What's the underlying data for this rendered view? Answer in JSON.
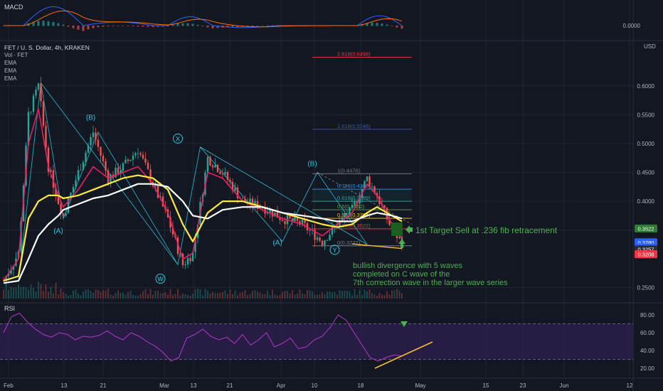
{
  "header": {
    "symbol": "FET / U. S. Dollar, 4h, KRAKEN",
    "indicators": [
      "Vol · FET",
      "EMA",
      "EMA",
      "EMA"
    ],
    "currency": "USD"
  },
  "macd": {
    "label": "MACD",
    "value_label": "0.0000"
  },
  "rsi": {
    "label": "RSI",
    "ticks": [
      80,
      60,
      40,
      20
    ],
    "tick_labels": [
      "80.00",
      "60.00",
      "40.00",
      "20.00"
    ],
    "band": [
      30,
      70
    ],
    "values": [
      60,
      78,
      82,
      72,
      64,
      58,
      55,
      60,
      58,
      52,
      56,
      55,
      57,
      62,
      56,
      52,
      60,
      56,
      50,
      45,
      38,
      28,
      32,
      54,
      58,
      64,
      56,
      52,
      55,
      48,
      58,
      46,
      52,
      60,
      44,
      48,
      54,
      42,
      44,
      52,
      56,
      66,
      80,
      74,
      60,
      46,
      32,
      28,
      32,
      35,
      34
    ]
  },
  "chart_data": {
    "type": "candlestick",
    "title": "FET / U. S. Dollar, 4h, KRAKEN",
    "ylabel": "USD",
    "ylim": [
      0.225,
      0.675
    ],
    "x_ticks": [
      "Feb",
      "13",
      "21",
      "Mar",
      "13",
      "21",
      "Apr",
      "10",
      "18",
      "May",
      "15",
      "23",
      "Jun",
      "12"
    ],
    "y_ticks": [
      "0.6000",
      "0.5500",
      "0.5000",
      "0.4500",
      "0.4000",
      "0.3500",
      "0.2500"
    ],
    "price_path": [
      {
        "t": 0,
        "p": 0.262
      },
      {
        "t": 3,
        "p": 0.31
      },
      {
        "t": 5,
        "p": 0.55
      },
      {
        "t": 7,
        "p": 0.6
      },
      {
        "t": 9,
        "p": 0.46
      },
      {
        "t": 11,
        "p": 0.4
      },
      {
        "t": 12,
        "p": 0.375
      },
      {
        "t": 15,
        "p": 0.45
      },
      {
        "t": 18,
        "p": 0.52
      },
      {
        "t": 21,
        "p": 0.44
      },
      {
        "t": 24,
        "p": 0.46
      },
      {
        "t": 27,
        "p": 0.49
      },
      {
        "t": 30,
        "p": 0.43
      },
      {
        "t": 33,
        "p": 0.37
      },
      {
        "t": 36,
        "p": 0.29
      },
      {
        "t": 38,
        "p": 0.31
      },
      {
        "t": 41,
        "p": 0.475
      },
      {
        "t": 44,
        "p": 0.45
      },
      {
        "t": 48,
        "p": 0.4
      },
      {
        "t": 52,
        "p": 0.39
      },
      {
        "t": 56,
        "p": 0.37
      },
      {
        "t": 60,
        "p": 0.36
      },
      {
        "t": 64,
        "p": 0.33
      },
      {
        "t": 67,
        "p": 0.36
      },
      {
        "t": 70,
        "p": 0.385
      },
      {
        "t": 73,
        "p": 0.44
      },
      {
        "t": 75,
        "p": 0.41
      },
      {
        "t": 78,
        "p": 0.35
      },
      {
        "t": 80,
        "p": 0.33
      }
    ],
    "ema_series": [
      {
        "color": "#e91e63",
        "values": [
          0.262,
          0.3,
          0.5,
          0.56,
          0.46,
          0.41,
          0.39,
          0.42,
          0.46,
          0.44,
          0.45,
          0.46,
          0.43,
          0.38,
          0.3,
          0.31,
          0.45,
          0.44,
          0.4,
          0.385,
          0.37,
          0.36,
          0.34,
          0.36,
          0.38,
          0.43,
          0.41,
          0.36,
          0.335
        ]
      },
      {
        "color": "#ffeb3b",
        "values": [
          0.262,
          0.27,
          0.37,
          0.4,
          0.41,
          0.41,
          0.405,
          0.41,
          0.42,
          0.43,
          0.44,
          0.445,
          0.44,
          0.42,
          0.36,
          0.33,
          0.38,
          0.4,
          0.4,
          0.39,
          0.38,
          0.37,
          0.36,
          0.355,
          0.36,
          0.38,
          0.39,
          0.375,
          0.365
        ]
      },
      {
        "color": "#ffffff",
        "values": [
          0.258,
          0.262,
          0.3,
          0.34,
          0.36,
          0.375,
          0.385,
          0.395,
          0.405,
          0.41,
          0.42,
          0.43,
          0.43,
          0.425,
          0.4,
          0.375,
          0.37,
          0.385,
          0.39,
          0.39,
          0.38,
          0.375,
          0.37,
          0.365,
          0.365,
          0.375,
          0.38,
          0.375,
          0.37
        ]
      }
    ],
    "fib_levels": [
      {
        "label": "2.618(0.6498)",
        "value": 0.6498,
        "color": "#f23645"
      },
      {
        "label": "1.618(0.5248)",
        "value": 0.5248,
        "color": "#3f51b5"
      },
      {
        "label": "1(0.4476)",
        "value": 0.4476,
        "color": "#787b86"
      },
      {
        "label": "0.786(0.4209)",
        "value": 0.4209,
        "color": "#2196f3"
      },
      {
        "label": "0.618(0.3999)",
        "value": 0.3999,
        "color": "#26a69a"
      },
      {
        "label": "0.5(0.3852)",
        "value": 0.3852,
        "color": "#4caf50"
      },
      {
        "label": "0.382(0.3704)",
        "value": 0.3704,
        "color": "#fbc02d"
      },
      {
        "label": "0.236(0.3522)",
        "value": 0.3522,
        "color": "#f23645"
      },
      {
        "label": "0(0.3227)",
        "value": 0.3227,
        "color": "#787b86"
      }
    ],
    "wave_labels": [
      {
        "text": "(A)",
        "t": 11,
        "p": 0.345
      },
      {
        "text": "(B)",
        "t": 17.5,
        "p": 0.542
      },
      {
        "text": "W",
        "t": 31.5,
        "p": 0.262
      },
      {
        "text": "X",
        "t": 35,
        "p": 0.505
      },
      {
        "text": "(A)",
        "t": 55,
        "p": 0.325
      },
      {
        "text": "(B)",
        "t": 62,
        "p": 0.462
      },
      {
        "text": "Y",
        "t": 66.5,
        "p": 0.312
      }
    ],
    "price_badges": [
      {
        "label": "0.3522",
        "value": 0.3522,
        "color": "#2e7d32"
      },
      {
        "label": "FETUSD",
        "value": 0.329,
        "color": "#2a2e39"
      },
      {
        "label": "0.3280",
        "value": 0.328,
        "color": "#2962ff"
      },
      {
        "label": "40:39",
        "value": 0.319,
        "color": "#2962ff"
      },
      {
        "label": "0.3257",
        "value": 0.316,
        "color": "#2a2e39"
      },
      {
        "label": "0.3208",
        "value": 0.3075,
        "color": "#f23645"
      }
    ]
  },
  "annotations": {
    "target": "1st Target Sell at .236 fib retracement",
    "note_lines": [
      "bullish divergence with 5 waves",
      "completed on C wave of the",
      "7th correction wave in the larger wave series"
    ]
  },
  "colors": {
    "background": "#131722",
    "grid": "#2a2e39",
    "axis_text": "#b2b5be",
    "pattern": "#26c6da",
    "annotation": "#4caf50",
    "rsi_line": "#b039c8",
    "rsi_band": "#2d1f4e"
  }
}
